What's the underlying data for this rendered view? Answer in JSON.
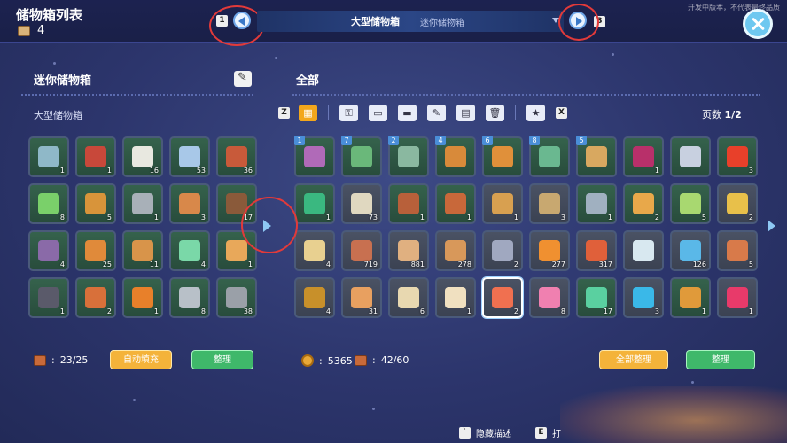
{
  "header": {
    "title": "储物箱列表",
    "count": "4",
    "prev_key": "1",
    "next_key": "3",
    "selected_box": "大型储物箱",
    "next_box": "迷你储物箱",
    "watermark": "开发中版本，不代表最终品质"
  },
  "left_panel": {
    "title": "迷你储物箱",
    "subtitle": "大型储物箱",
    "slots": [
      {
        "qty": "1",
        "color": "#8fb8c8",
        "icon": "chair-icon"
      },
      {
        "qty": "1",
        "color": "#c8483a",
        "icon": "brick-stack-icon"
      },
      {
        "qty": "16",
        "color": "#e8e8e0",
        "icon": "basin-icon"
      },
      {
        "qty": "53",
        "color": "#a8c8e8",
        "icon": "glass-icon"
      },
      {
        "qty": "36",
        "color": "#c85a3a",
        "icon": "chest-icon"
      },
      {
        "qty": "8",
        "color": "#7ad06a",
        "icon": "green-bar-icon"
      },
      {
        "qty": "5",
        "color": "#d8943a",
        "icon": "plank-icon"
      },
      {
        "qty": "1",
        "color": "#a8b0b8",
        "icon": "metal-plate-icon"
      },
      {
        "qty": "3",
        "color": "#d8884a",
        "icon": "wood-board-icon"
      },
      {
        "qty": "17",
        "color": "#8a5a3a",
        "icon": "dark-board-icon"
      },
      {
        "qty": "4",
        "color": "#8a6aa8",
        "icon": "pipe-icon"
      },
      {
        "qty": "25",
        "color": "#e08a3a",
        "icon": "copper-bar-icon"
      },
      {
        "qty": "11",
        "color": "#d8944a",
        "icon": "wood-bar-icon"
      },
      {
        "qty": "4",
        "color": "#7ad8a8",
        "icon": "jade-bar-icon"
      },
      {
        "qty": "1",
        "color": "#e8a85a",
        "icon": "stick-icon"
      },
      {
        "qty": "1",
        "color": "#5a5a6a",
        "icon": "wire-icon"
      },
      {
        "qty": "2",
        "color": "#d8703a",
        "icon": "ring-icon"
      },
      {
        "qty": "1",
        "color": "#e8802a",
        "icon": "gear-icon"
      },
      {
        "qty": "8",
        "color": "#b8c0c8",
        "icon": "bolt-icon"
      },
      {
        "qty": "38",
        "color": "#9aa0a8",
        "icon": "coil-icon"
      }
    ],
    "capacity": "23/25",
    "auto_fill_label": "自动填充",
    "sort_label": "整理"
  },
  "right_panel": {
    "title": "全部",
    "page_label": "页数",
    "page_value": "1/2",
    "tabs": [
      {
        "icon": "grid-icon",
        "glyph": "▦",
        "active": true
      },
      {
        "icon": "key-tool-icon",
        "glyph": "⚿",
        "active": false
      },
      {
        "icon": "sofa-icon",
        "glyph": "▭",
        "active": false
      },
      {
        "icon": "workbench-icon",
        "glyph": "▬",
        "active": false
      },
      {
        "icon": "brush-icon",
        "glyph": "✎",
        "active": false
      },
      {
        "icon": "chart-board-icon",
        "glyph": "▤",
        "active": false
      },
      {
        "icon": "trash-icon",
        "glyph": "🗑",
        "active": false
      },
      {
        "icon": "star-icon",
        "glyph": "★",
        "active": false
      }
    ],
    "key_left": "Z",
    "key_right": "X",
    "slots": [
      {
        "qty": "",
        "badge": "1",
        "color": "#b06ab8",
        "icon": "pickaxe-icon",
        "gray": false
      },
      {
        "qty": "",
        "badge": "7",
        "color": "#6ab87a",
        "icon": "green-pickaxe-icon",
        "gray": false
      },
      {
        "qty": "",
        "badge": "2",
        "color": "#8ab8a0",
        "icon": "axe-icon",
        "gray": false
      },
      {
        "qty": "",
        "badge": "4",
        "color": "#d88a3a",
        "icon": "basket-icon",
        "gray": false
      },
      {
        "qty": "",
        "badge": "6",
        "color": "#e0903a",
        "icon": "torch-icon",
        "gray": false
      },
      {
        "qty": "",
        "badge": "8",
        "color": "#6ab890",
        "icon": "blocks-icon",
        "gray": false
      },
      {
        "qty": "",
        "badge": "5",
        "color": "#d8a860",
        "icon": "knife-icon",
        "gray": false
      },
      {
        "qty": "1",
        "badge": "",
        "color": "#b8306a",
        "icon": "hat-icon",
        "gray": false
      },
      {
        "qty": "",
        "badge": "",
        "color": "#c8d0e0",
        "icon": "stones-icon",
        "gray": false
      },
      {
        "qty": "3",
        "badge": "",
        "color": "#e8402a",
        "icon": "red-block-icon",
        "gray": false
      },
      {
        "qty": "1",
        "badge": "",
        "color": "#3ab880",
        "icon": "green-book-icon",
        "gray": false
      },
      {
        "qty": "73",
        "badge": "",
        "color": "#e0d8c0",
        "icon": "stone-pile-icon",
        "gray": true
      },
      {
        "qty": "1",
        "badge": "",
        "color": "#b8603a",
        "icon": "crate-icon",
        "gray": false
      },
      {
        "qty": "1",
        "badge": "",
        "color": "#c8683a",
        "icon": "vase-icon",
        "gray": false
      },
      {
        "qty": "1",
        "badge": "",
        "color": "#d8a050",
        "icon": "sand-pile-icon",
        "gray": true
      },
      {
        "qty": "3",
        "badge": "",
        "color": "#c8a870",
        "icon": "ore-pile-icon",
        "gray": true
      },
      {
        "qty": "1",
        "badge": "",
        "color": "#a0b0c0",
        "icon": "steel-plate-icon",
        "gray": false
      },
      {
        "qty": "2",
        "badge": "",
        "color": "#e8a84a",
        "icon": "horn-icon",
        "gray": false
      },
      {
        "qty": "5",
        "badge": "",
        "color": "#a8d870",
        "icon": "mushroom-icon",
        "gray": false
      },
      {
        "qty": "2",
        "badge": "",
        "color": "#e8c04a",
        "icon": "id-card-icon",
        "gray": true
      },
      {
        "qty": "4",
        "badge": "",
        "color": "#e8d090",
        "icon": "paper-icon",
        "gray": true
      },
      {
        "qty": "719",
        "badge": "",
        "color": "#c87050",
        "icon": "clay-brick-icon",
        "gray": true
      },
      {
        "qty": "881",
        "badge": "",
        "color": "#e0b080",
        "icon": "sand-icon",
        "gray": true
      },
      {
        "qty": "278",
        "badge": "",
        "color": "#d8985a",
        "icon": "dirt-pile-icon",
        "gray": true
      },
      {
        "qty": "2",
        "badge": "",
        "color": "#a0a8c0",
        "icon": "rock-icon",
        "gray": true
      },
      {
        "qty": "277",
        "badge": "",
        "color": "#f09030",
        "icon": "flower-ore-icon",
        "gray": true
      },
      {
        "qty": "317",
        "badge": "",
        "color": "#e0603a",
        "icon": "red-ore-icon",
        "gray": true
      },
      {
        "qty": "",
        "badge": "",
        "color": "#d8e8f0",
        "icon": "crystal-icon",
        "gray": true
      },
      {
        "qty": "126",
        "badge": "",
        "color": "#5ab8e8",
        "icon": "blue-crystal-icon",
        "gray": true
      },
      {
        "qty": "5",
        "badge": "",
        "color": "#d87a4a",
        "icon": "leaf-pile-icon",
        "gray": true
      },
      {
        "qty": "4",
        "badge": "",
        "color": "#c8902a",
        "icon": "dung-icon",
        "gray": true
      },
      {
        "qty": "31",
        "badge": "",
        "color": "#e8a060",
        "icon": "wood-shard-icon",
        "gray": true
      },
      {
        "qty": "6",
        "badge": "",
        "color": "#e8d8b0",
        "icon": "rope-icon",
        "gray": true
      },
      {
        "qty": "1",
        "badge": "",
        "color": "#f0e0c0",
        "icon": "thorn-icon",
        "gray": true
      },
      {
        "qty": "2",
        "badge": "",
        "color": "#f07050",
        "icon": "red-disc-icon",
        "gray": true,
        "selected": true
      },
      {
        "qty": "8",
        "badge": "",
        "color": "#f080b0",
        "icon": "worm-icon",
        "gray": true
      },
      {
        "qty": "17",
        "badge": "",
        "color": "#5ad0a0",
        "icon": "bucket-icon",
        "gray": false
      },
      {
        "qty": "3",
        "badge": "",
        "color": "#3ab8e8",
        "icon": "cube-icon",
        "gray": true
      },
      {
        "qty": "1",
        "badge": "",
        "color": "#e09a3a",
        "icon": "toolbox-icon",
        "gray": false
      },
      {
        "qty": "1",
        "badge": "",
        "color": "#e83a6a",
        "icon": "firework-icon",
        "gray": true
      }
    ],
    "coins": "5365",
    "capacity": "42/60",
    "sort_all_label": "全部整理",
    "sort_label": "整理"
  },
  "footer": {
    "hide_desc_key": "`",
    "hide_desc_label": "隐藏描述",
    "e_key": "E",
    "e_label": "打"
  }
}
